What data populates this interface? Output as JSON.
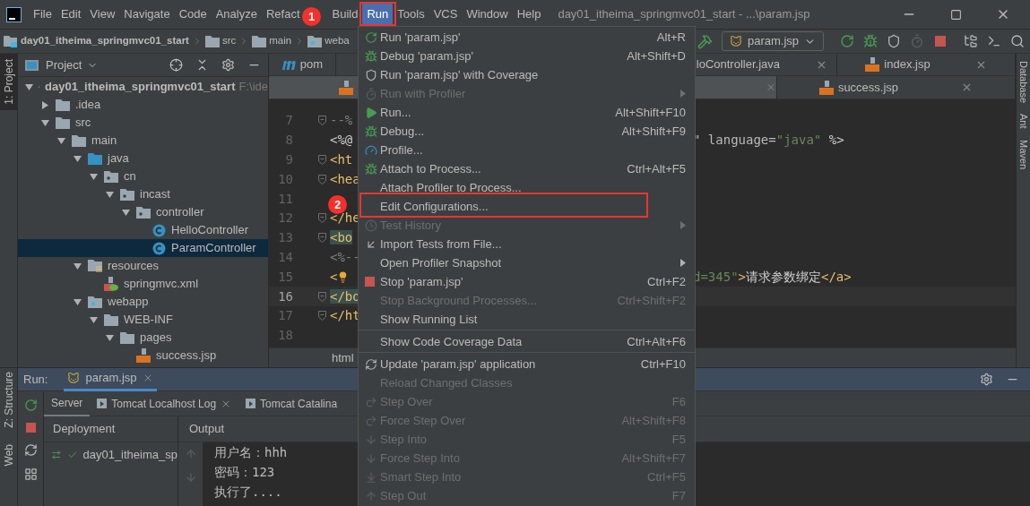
{
  "title_bar": {
    "menus": [
      {
        "label": "File",
        "selected": false
      },
      {
        "label": "Edit",
        "selected": false
      },
      {
        "label": "View",
        "selected": false
      },
      {
        "label": "Navigate",
        "selected": false
      },
      {
        "label": "Code",
        "selected": false
      },
      {
        "label": "Analyze",
        "selected": false
      },
      {
        "label": "Refact",
        "selected": false
      },
      {
        "label": "Build",
        "selected": false
      },
      {
        "label": "Run",
        "selected": true
      },
      {
        "label": "Tools",
        "selected": false
      },
      {
        "label": "VCS",
        "selected": false
      },
      {
        "label": "Window",
        "selected": false
      },
      {
        "label": "Help",
        "selected": false
      }
    ],
    "title": "day01_itheima_springmvc01_start - ...\\param.jsp"
  },
  "nav_bar": {
    "breadcrumbs": [
      "day01_itheima_springmvc01_start",
      "src",
      "main",
      "weba"
    ],
    "run_config": "param.jsp"
  },
  "left_tool_strip": {
    "top": [
      {
        "label": "1: Project",
        "selected": true
      }
    ],
    "bottom": [
      {
        "label": "Z: Structure",
        "selected": false
      },
      {
        "label": "Web",
        "selected": false
      }
    ]
  },
  "project_panel": {
    "title": "Project",
    "tree": [
      {
        "label": "day01_itheima_springmvc01_start",
        "hint": "F:\\ide",
        "kind": "module",
        "expanded": true,
        "selected": false,
        "children": [
          {
            "label": ".idea",
            "kind": "folder",
            "expanded": false,
            "selected": false
          },
          {
            "label": "src",
            "kind": "folder",
            "expanded": true,
            "selected": false,
            "children": [
              {
                "label": "main",
                "kind": "folder",
                "expanded": true,
                "selected": false,
                "children": [
                  {
                    "label": "java",
                    "kind": "source-folder",
                    "expanded": true,
                    "selected": false,
                    "children": [
                      {
                        "label": "cn",
                        "kind": "package",
                        "expanded": true,
                        "selected": false,
                        "children": [
                          {
                            "label": "incast",
                            "kind": "package",
                            "expanded": true,
                            "selected": false,
                            "children": [
                              {
                                "label": "controller",
                                "kind": "package",
                                "expanded": true,
                                "selected": false,
                                "children": [
                                  {
                                    "label": "HelloController",
                                    "kind": "class",
                                    "selected": false
                                  },
                                  {
                                    "label": "ParamController",
                                    "kind": "class",
                                    "selected": true
                                  }
                                ]
                              }
                            ]
                          }
                        ]
                      }
                    ]
                  },
                  {
                    "label": "resources",
                    "kind": "resource-folder",
                    "expanded": true,
                    "selected": false,
                    "children": [
                      {
                        "label": "springmvc.xml",
                        "kind": "xml",
                        "selected": false
                      }
                    ]
                  },
                  {
                    "label": "webapp",
                    "kind": "web-folder",
                    "expanded": true,
                    "selected": false,
                    "children": [
                      {
                        "label": "WEB-INF",
                        "kind": "folder",
                        "expanded": true,
                        "selected": false,
                        "children": [
                          {
                            "label": "pages",
                            "kind": "folder",
                            "expanded": true,
                            "selected": false,
                            "children": [
                              {
                                "label": "success.jsp",
                                "kind": "jsp",
                                "selected": false
                              }
                            ]
                          }
                        ]
                      }
                    ]
                  }
                ]
              }
            ]
          }
        ]
      }
    ]
  },
  "editor": {
    "tab_rows": [
      [
        {
          "label": "pom",
          "kind": "maven",
          "selected": false,
          "closable": false
        },
        {
          "label": "loController.java",
          "kind": "java",
          "selected": false,
          "closable": true
        },
        {
          "label": "index.jsp",
          "kind": "jsp",
          "selected": false,
          "closable": true
        }
      ],
      [
        {
          "kind": "jsp",
          "selected": true,
          "closable": true
        },
        {
          "label": "success.jsp",
          "kind": "jsp",
          "selected": false,
          "closable": true
        }
      ]
    ],
    "lines": [
      {
        "number": "7",
        "fold": true,
        "current": false,
        "matched": false,
        "left": [
          {
            "text": "--%",
            "kind": "comment"
          }
        ]
      },
      {
        "number": "8",
        "fold": false,
        "current": false,
        "matched": false,
        "left": [
          {
            "text": "<%@",
            "kind": "plain"
          }
        ],
        "right": [
          {
            "text": "\" language=",
            "kind": "attr"
          },
          {
            "text": "\"java\"",
            "kind": "string"
          },
          {
            "text": " %>",
            "kind": "plain"
          }
        ]
      },
      {
        "number": "9",
        "fold": true,
        "current": false,
        "matched": false,
        "left": [
          {
            "text": "<ht",
            "kind": "tag"
          }
        ]
      },
      {
        "number": "10",
        "fold": true,
        "current": false,
        "matched": false,
        "left": [
          {
            "text": "<hea",
            "kind": "tag"
          }
        ]
      },
      {
        "number": "11",
        "fold": false,
        "current": false
      },
      {
        "number": "12",
        "fold": true,
        "current": false,
        "matched": false,
        "left": [
          {
            "text": "</he",
            "kind": "tag"
          }
        ]
      },
      {
        "number": "13",
        "fold": true,
        "current": false,
        "matched": true,
        "left": [
          {
            "text": "<bo",
            "kind": "tag"
          }
        ]
      },
      {
        "number": "14",
        "fold": false,
        "current": false,
        "matched": false,
        "left": [
          {
            "text": "<%--",
            "kind": "comment"
          }
        ]
      },
      {
        "number": "15",
        "fold": false,
        "current": false,
        "matched": false,
        "left": [
          {
            "text": "<",
            "kind": "tag"
          },
          {
            "kind": "bulb"
          }
        ],
        "right": [
          {
            "text": "d=345\"",
            "kind": "string"
          },
          {
            "text": ">",
            "kind": "tag"
          },
          {
            "text": "请求参数绑定",
            "kind": "plain"
          },
          {
            "text": "</a>",
            "kind": "tag"
          }
        ]
      },
      {
        "number": "16",
        "fold": true,
        "current": true,
        "matched": true,
        "left": [
          {
            "text": "</bo",
            "kind": "tag"
          }
        ]
      },
      {
        "number": "17",
        "fold": true,
        "current": false,
        "matched": false,
        "left": [
          {
            "text": "</ht",
            "kind": "tag"
          }
        ]
      },
      {
        "number": "18",
        "fold": false,
        "current": false
      }
    ],
    "breadcrumb": "html"
  },
  "right_tool_strip": [
    "Database",
    "Ant",
    "Maven"
  ],
  "run_menu": {
    "items": [
      {
        "kind": "item",
        "label": "Run 'param.jsp'",
        "shortcut": "Alt+R",
        "disabled": false,
        "submenu": false
      },
      {
        "kind": "item",
        "label": "Debug 'param.jsp'",
        "shortcut": "Alt+Shift+D",
        "disabled": false,
        "submenu": false
      },
      {
        "kind": "item",
        "label": "Run 'param.jsp' with Coverage",
        "disabled": false,
        "submenu": false
      },
      {
        "kind": "item",
        "label": "Run with Profiler",
        "disabled": true,
        "submenu": true
      },
      {
        "kind": "item",
        "label": "Run...",
        "shortcut": "Alt+Shift+F10",
        "disabled": false,
        "submenu": false
      },
      {
        "kind": "item",
        "label": "Debug...",
        "shortcut": "Alt+Shift+F9",
        "disabled": false,
        "submenu": false
      },
      {
        "kind": "item",
        "label": "Profile...",
        "disabled": false,
        "submenu": false
      },
      {
        "kind": "item",
        "label": "Attach to Process...",
        "shortcut": "Ctrl+Alt+F5",
        "disabled": false,
        "submenu": false
      },
      {
        "kind": "item",
        "label": "Attach Profiler to Process...",
        "disabled": false,
        "submenu": false
      },
      {
        "kind": "item",
        "label": "Edit Configurations...",
        "disabled": false,
        "submenu": false
      },
      {
        "kind": "item",
        "label": "Test History",
        "disabled": true,
        "submenu": true
      },
      {
        "kind": "item",
        "label": "Import Tests from File...",
        "disabled": false,
        "submenu": false
      },
      {
        "kind": "item",
        "label": "Open Profiler Snapshot",
        "disabled": false,
        "submenu": true
      },
      {
        "kind": "item",
        "label": "Stop 'param.jsp'",
        "shortcut": "Ctrl+F2",
        "disabled": false,
        "submenu": false
      },
      {
        "kind": "item",
        "label": "Stop Background Processes...",
        "shortcut": "Ctrl+Shift+F2",
        "disabled": true,
        "submenu": false
      },
      {
        "kind": "item",
        "label": "Show Running List",
        "disabled": false,
        "submenu": false
      },
      {
        "kind": "separator"
      },
      {
        "kind": "item",
        "label": "Show Code Coverage Data",
        "shortcut": "Ctrl+Alt+F6",
        "disabled": false,
        "submenu": false
      },
      {
        "kind": "separator"
      },
      {
        "kind": "item",
        "label": "Update 'param.jsp' application",
        "shortcut": "Ctrl+F10",
        "disabled": false,
        "submenu": false
      },
      {
        "kind": "item",
        "label": "Reload Changed Classes",
        "disabled": true,
        "submenu": false
      },
      {
        "kind": "item",
        "label": "Step Over",
        "shortcut": "F6",
        "disabled": true,
        "submenu": false
      },
      {
        "kind": "item",
        "label": "Force Step Over",
        "shortcut": "Alt+Shift+F8",
        "disabled": true,
        "submenu": false
      },
      {
        "kind": "item",
        "label": "Step Into",
        "shortcut": "F5",
        "disabled": true,
        "submenu": false
      },
      {
        "kind": "item",
        "label": "Force Step Into",
        "shortcut": "Alt+Shift+F7",
        "disabled": true,
        "submenu": false
      },
      {
        "kind": "item",
        "label": "Smart Step Into",
        "shortcut": "Ctrl+F5",
        "disabled": true,
        "submenu": false
      },
      {
        "kind": "item",
        "label": "Step Out",
        "shortcut": "F7",
        "disabled": true,
        "submenu": false
      }
    ]
  },
  "run_panel": {
    "label": "Run:",
    "tabs": [
      {
        "label": "param.jsp",
        "selected": true
      }
    ],
    "sub_tabs": [
      {
        "label": "Server",
        "kind": "plain",
        "selected": true,
        "closable": false
      },
      {
        "label": "Tomcat Localhost Log",
        "kind": "log",
        "selected": false,
        "closable": true
      },
      {
        "label": "Tomcat Catalina",
        "kind": "log",
        "selected": false,
        "closable": false
      }
    ],
    "columns": [
      "Deployment",
      "Output"
    ],
    "deployments": [
      {
        "label": "day01_itheima_sp",
        "ok": true
      }
    ],
    "output": [
      "用户名：hhh",
      "密码：123",
      "执行了...."
    ]
  },
  "annotations": [
    {
      "label": "1"
    },
    {
      "label": "2"
    }
  ]
}
